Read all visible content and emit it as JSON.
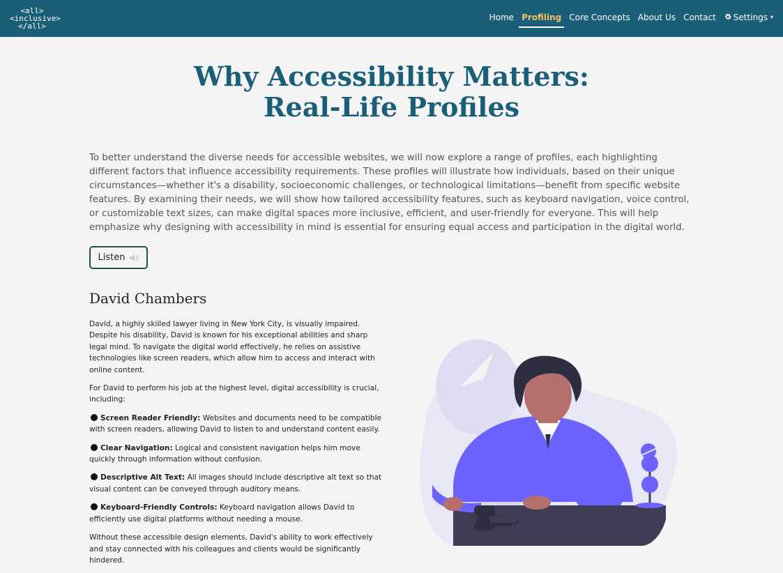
{
  "logo": {
    "line1": "<all>",
    "line2": "<inclusive>",
    "line3": "</all>"
  },
  "nav": {
    "items": [
      {
        "label": "Home",
        "active": false
      },
      {
        "label": "Profiling",
        "active": true
      },
      {
        "label": "Core Concepts",
        "active": false
      },
      {
        "label": "About Us",
        "active": false
      },
      {
        "label": "Contact",
        "active": false
      }
    ],
    "settings_label": "Settings",
    "settings_icon": "gear-icon",
    "settings_caret": "▾"
  },
  "title": {
    "line1": "Why Accessibility Matters:",
    "line2": "Real-Life Profiles"
  },
  "intro": "To better understand the diverse needs for accessible websites, we will now explore a range of profiles, each highlighting different factors that influence accessibility requirements. These profiles will illustrate how individuals, based on their unique circumstances—whether it's a disability, socioeconomic challenges, or technological limitations—benefit from specific website features. By examining their needs, we will show how tailored accessibility features, such as keyboard navigation, voice control, or customizable text sizes, can make digital spaces more inclusive, efficient, and user-friendly for everyone. This will help emphasize why designing with accessibility in mind is essential for ensuring equal access and participation in the digital world.",
  "listen_button": {
    "label": "Listen",
    "icon": "speaker-icon"
  },
  "profile": {
    "name": "David Chambers",
    "para1": "David, a highly skilled lawyer living in New York City, is visually impaired. Despite his disability, David is known for his exceptional abilities and sharp legal mind. To navigate the digital world effectively, he relies on assistive technologies like screen readers, which allow him to access and interact with online content.",
    "para2": "For David to perform his job at the highest level, digital accessibility is crucial, including:",
    "features": [
      {
        "title": "Screen Reader Friendly:",
        "text": " Websites and documents need to be compatible with screen readers, allowing David to listen to and understand content easily."
      },
      {
        "title": "Clear Navigation:",
        "text": " Logical and consistent navigation helps him move quickly through information without confusion."
      },
      {
        "title": "Descriptive Alt Text:",
        "text": " All images should include descriptive alt text so that visual content can be conveyed through auditory means."
      },
      {
        "title": "Keyboard-Friendly Controls:",
        "text": " Keyboard navigation allows David to efficiently use digital platforms without needing a mouse."
      }
    ],
    "closing": "Without these accessible design elements, David's ability to work effectively and stay connected with his colleagues and clients would be significantly hindered."
  },
  "colors": {
    "navbar": "#1b5e78",
    "active_nav": "#f4c15d",
    "title": "#1b5e78",
    "button_border": "#1e5148",
    "illustration_purple": "#6c63ff"
  }
}
